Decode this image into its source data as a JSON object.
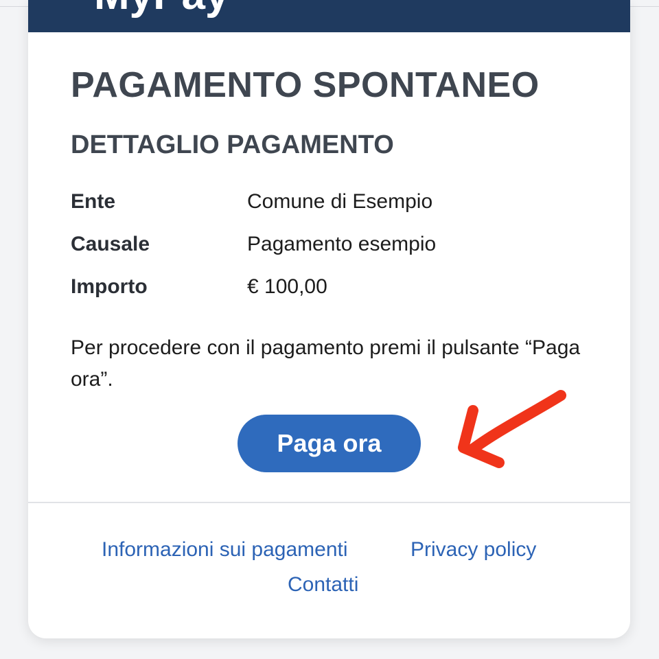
{
  "header": {
    "title": "MyPay"
  },
  "page_title": "PAGAMENTO SPONTANEO",
  "section_title": "DETTAGLIO PAGAMENTO",
  "details": [
    {
      "label": "Ente",
      "value": "Comune di Esempio"
    },
    {
      "label": "Causale",
      "value": "Pagamento esempio"
    },
    {
      "label": "Importo",
      "value": "€ 100,00"
    }
  ],
  "instructions": "Per procedere con il pagamento premi il pulsante “Paga ora”.",
  "pay_button": {
    "label": "Paga ora"
  },
  "footer": {
    "links": [
      {
        "label": "Informazioni sui pagamenti"
      },
      {
        "label": "Privacy policy"
      },
      {
        "label": "Contatti"
      }
    ]
  },
  "colors": {
    "header_bg": "#1f3a5f",
    "button_bg": "#2f6bbd",
    "link": "#2c63b5",
    "arrow": "#f0341a"
  },
  "icons": {
    "annotation": "red-arrow-icon"
  }
}
